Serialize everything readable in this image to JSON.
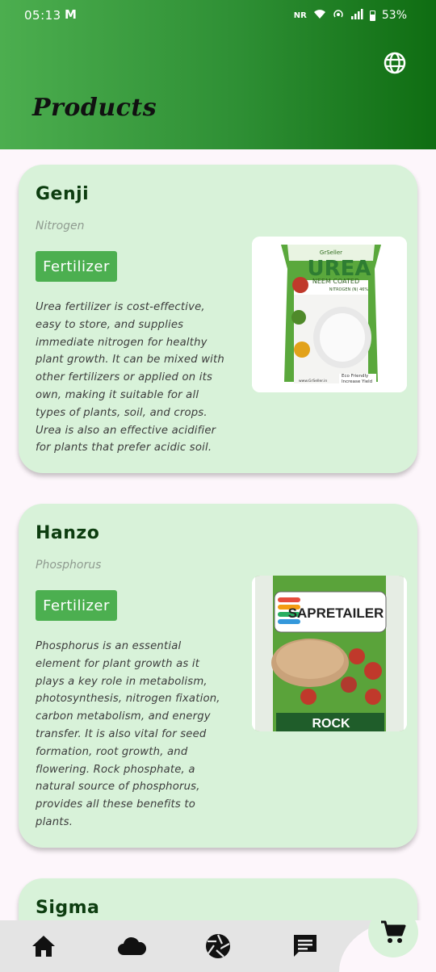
{
  "status_bar": {
    "time": "05:13",
    "mail_icon": "gmail-icon",
    "network": "NR",
    "battery": "53%"
  },
  "header": {
    "title": "Products",
    "language_icon": "globe-icon"
  },
  "products": [
    {
      "name": "Genji",
      "nutrient": "Nitrogen",
      "category": "Fertilizer",
      "description": "Urea fertilizer is cost-effective, easy to store, and supplies immediate nitrogen for healthy plant growth. It can be mixed with other fertilizers or applied on its own, making it suitable for all types of plants, soil, and crops. Urea is also an effective acidifier for plants that prefer acidic soil.",
      "image": {
        "brand_small": "GrSeller",
        "headline": "UREA",
        "line1": "NEEM COATED",
        "line2": "NITROGEN (N) 46%",
        "badge1": "Eco Friendly",
        "badge2": "Increase Yield",
        "footer": "www.GrSeller.in"
      }
    },
    {
      "name": "Hanzo",
      "nutrient": "Phosphorus",
      "category": "Fertilizer",
      "description": "Phosphorus is an essential element for plant growth as it plays a key role in metabolism, photosynthesis, nitrogen fixation, carbon metabolism, and energy transfer. It is also vital for seed formation, root growth, and flowering. Rock phosphate, a natural source of phosphorus, provides all these benefits to plants.",
      "image": {
        "brand": "SAPRETAILER",
        "label": "ROCK"
      }
    },
    {
      "name": "Sigma"
    }
  ],
  "bottom_nav": {
    "items": [
      "home-icon",
      "cloud-icon",
      "camera-aperture-icon",
      "chat-icon"
    ],
    "fab_icon": "cart-icon"
  },
  "colors": {
    "header_start": "#4cae4f",
    "header_end": "#0f6d12",
    "card_bg": "#d8f2d9",
    "tag_bg": "#4caf50",
    "title_color": "#0d3d10"
  }
}
